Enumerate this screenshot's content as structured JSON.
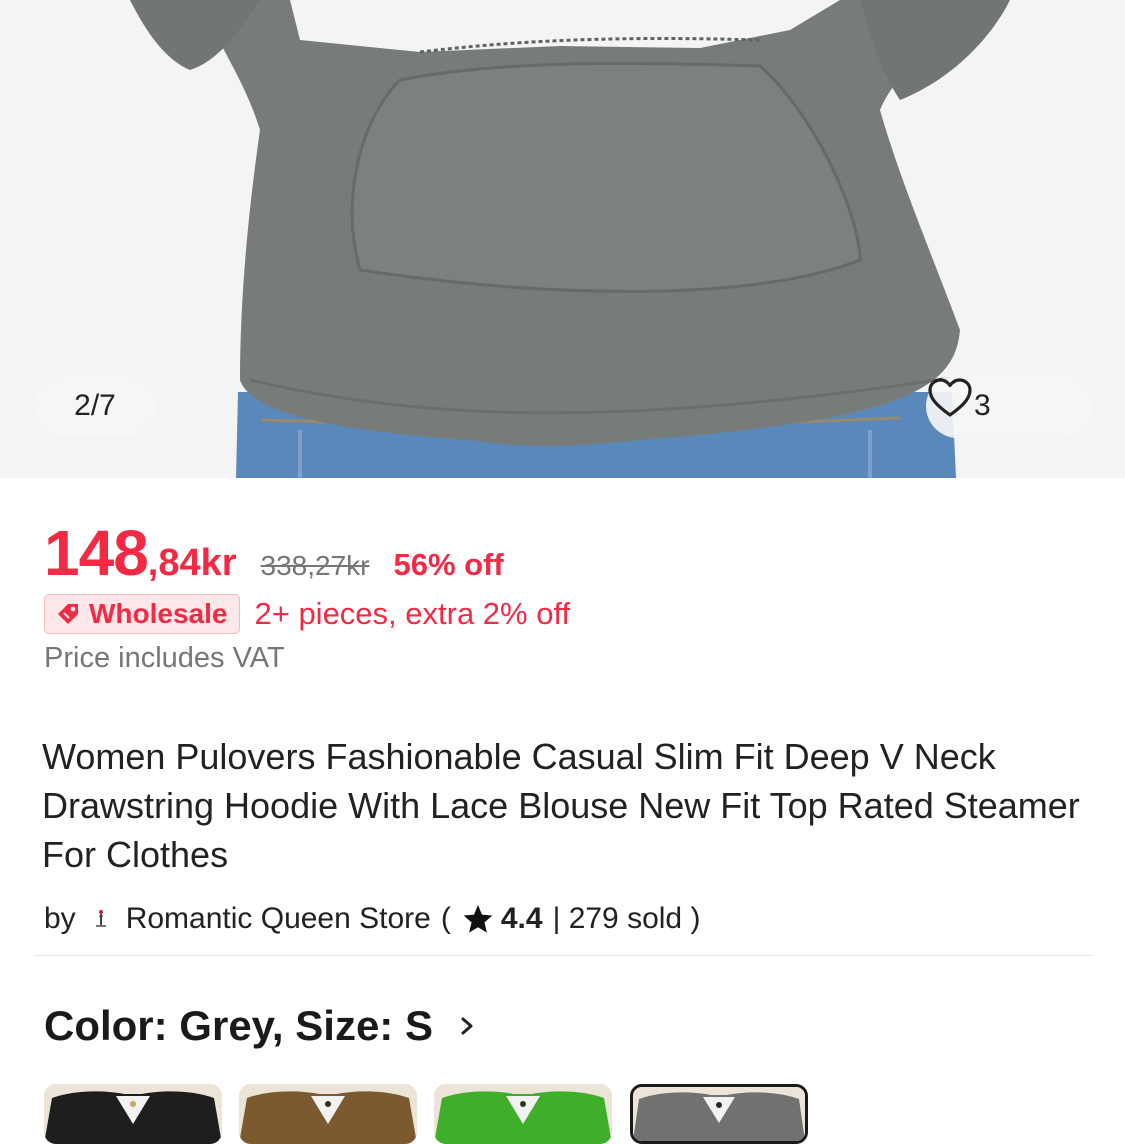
{
  "gallery": {
    "counter": "2/7",
    "favorites_count": "3",
    "colors": {
      "hoodie": "#787c78",
      "jeans": "#5b88bb",
      "background": "#f4f4f4"
    }
  },
  "price": {
    "integer": "148",
    "decimal": ",84kr",
    "original": "338,27kr",
    "discount": "56% off"
  },
  "wholesale": {
    "badge": "Wholesale",
    "text": "2+ pieces, extra 2% off"
  },
  "vat_note": "Price includes VAT",
  "product": {
    "title": "Women Pulovers Fashionable Casual Slim Fit Deep V Neck Drawstring Hoodie With Lace Blouse New Fit Top Rated Steamer For Clothes"
  },
  "store": {
    "prefix": "by",
    "name": "Romantic Queen Store",
    "open_paren": "(",
    "rating": "4.4",
    "sold": "| 279 sold )"
  },
  "variant": {
    "label": "Color: Grey, Size: S",
    "thumbnails": [
      {
        "color_name": "black",
        "color": "#1e1e1e"
      },
      {
        "color_name": "brown",
        "color": "#7a5a2e"
      },
      {
        "color_name": "green",
        "color": "#3fae2a"
      },
      {
        "color_name": "grey",
        "color": "#6f726f",
        "selected": true
      }
    ]
  },
  "accent_color": "#f42a45"
}
